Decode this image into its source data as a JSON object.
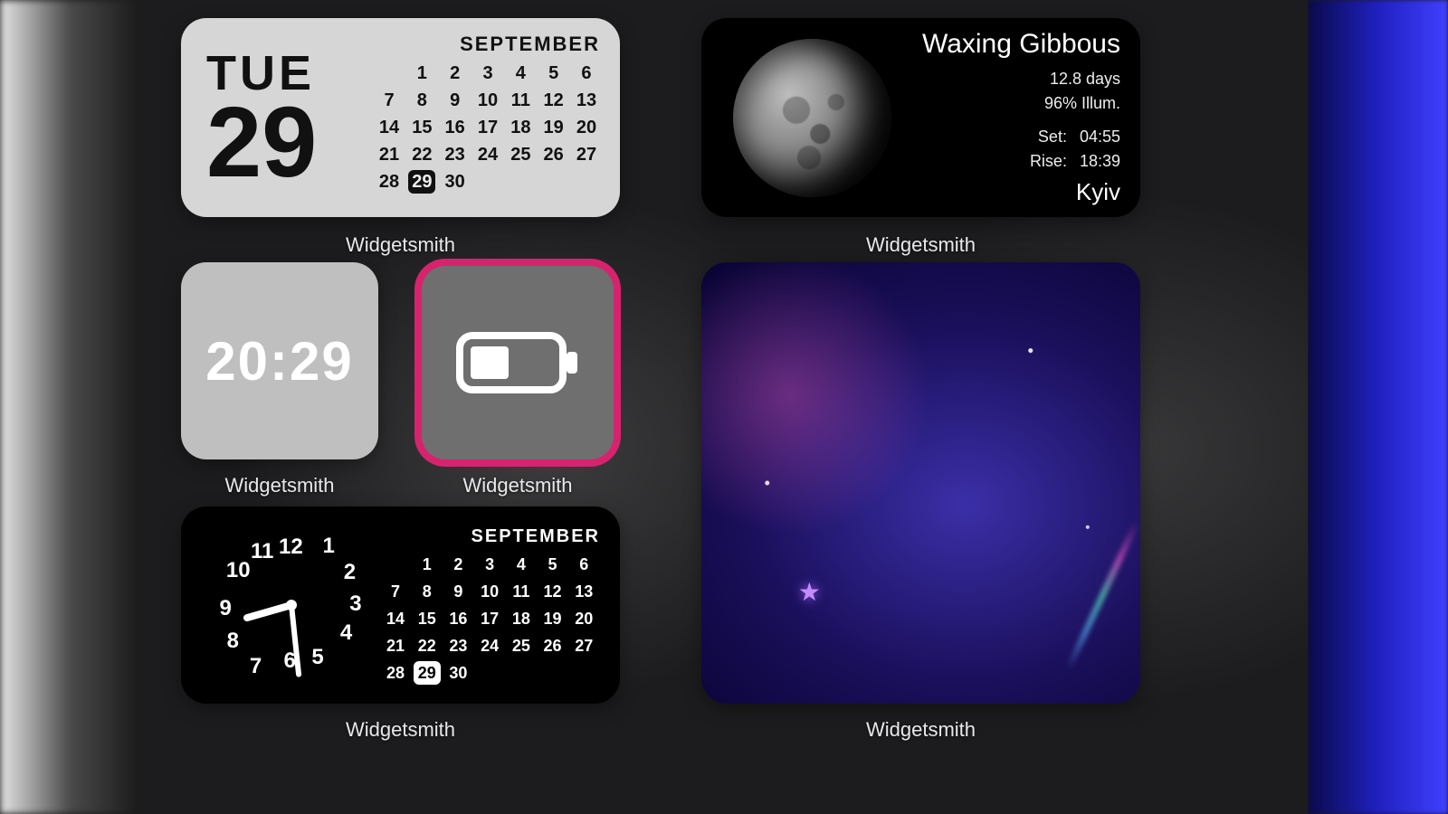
{
  "app_label": "Widgetsmith",
  "calendar_light": {
    "day_of_week": "TUE",
    "day_of_month": "29",
    "month": "SEPTEMBER",
    "days": [
      1,
      2,
      3,
      4,
      5,
      6,
      7,
      8,
      9,
      10,
      11,
      12,
      13,
      14,
      15,
      16,
      17,
      18,
      19,
      20,
      21,
      22,
      23,
      24,
      25,
      26,
      27,
      28,
      29,
      30
    ],
    "today": 29
  },
  "moon": {
    "phase": "Waxing Gibbous",
    "age": "12.8 days",
    "illum": "96% Illum.",
    "set_label": "Set:",
    "set_time": "04:55",
    "rise_label": "Rise:",
    "rise_time": "18:39",
    "city": "Kyiv"
  },
  "time_widget": {
    "time": "20:29"
  },
  "battery_widget": {
    "icon": "battery-half-icon",
    "selected": true,
    "accent": "#d7236e",
    "approx_level": 45
  },
  "analog_widget": {
    "month": "SEPTEMBER",
    "today": 29,
    "days": [
      1,
      2,
      3,
      4,
      5,
      6,
      7,
      8,
      9,
      10,
      11,
      12,
      13,
      14,
      15,
      16,
      17,
      18,
      19,
      20,
      21,
      22,
      23,
      24,
      25,
      26,
      27,
      28,
      29,
      30
    ],
    "time_represented": "20:29"
  },
  "photo_widget": {
    "description": "purple-blue nebula with stars"
  }
}
